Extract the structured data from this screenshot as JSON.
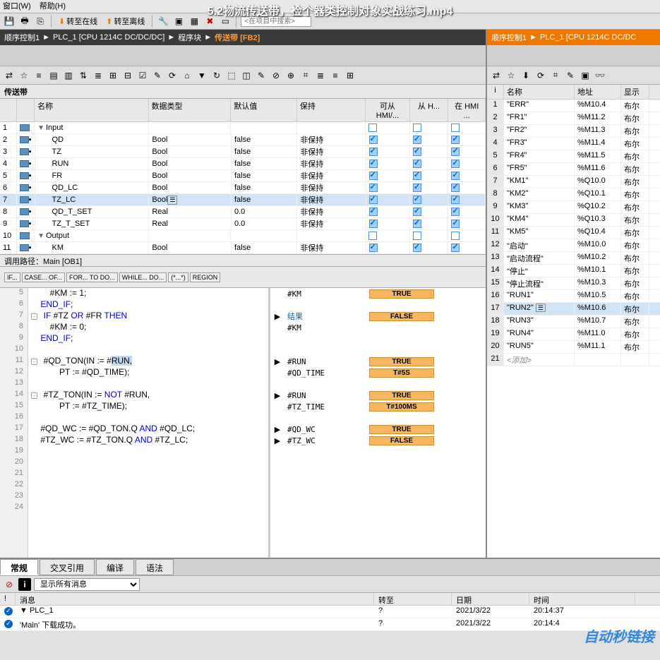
{
  "video_title": "5.2物流传送带，检个器类控制对象实战练习.mp4",
  "menu": {
    "window": "窗口(W)",
    "help": "帮助(H)"
  },
  "toolbar1": {
    "go_online": "转至在线",
    "go_offline": "转至离线",
    "search_placeholder": "<在项目中搜索>"
  },
  "breadcrumb_left": {
    "project": "顺序控制1",
    "plc": "PLC_1 [CPU 1214C DC/DC/DC]",
    "blocks": "程序块",
    "fb": "传送带 [FB2]"
  },
  "breadcrumb_right": {
    "project": "顺序控制1",
    "plc": "PLC_1 [CPU 1214C DC/DC"
  },
  "fb_title": "传送带",
  "var_headers": {
    "name": "名称",
    "dtype": "数据类型",
    "default": "默认值",
    "hold": "保持",
    "hmi1": "可从 HMI/...",
    "hmi2": "从 H...",
    "hmi3": "在 HMI ..."
  },
  "var_rows": [
    {
      "num": "1",
      "section": true,
      "name": "Input",
      "arrow": "▼"
    },
    {
      "num": "2",
      "name": "QD",
      "dtype": "Bool",
      "default": "false",
      "hold": "非保持",
      "c1": true,
      "c2": true,
      "c3": true
    },
    {
      "num": "3",
      "name": "TZ",
      "dtype": "Bool",
      "default": "false",
      "hold": "非保持",
      "c1": true,
      "c2": true,
      "c3": true
    },
    {
      "num": "4",
      "name": "RUN",
      "dtype": "Bool",
      "default": "false",
      "hold": "非保持",
      "c1": true,
      "c2": true,
      "c3": true
    },
    {
      "num": "5",
      "name": "FR",
      "dtype": "Bool",
      "default": "false",
      "hold": "非保持",
      "c1": true,
      "c2": true,
      "c3": true
    },
    {
      "num": "6",
      "name": "QD_LC",
      "dtype": "Bool",
      "default": "false",
      "hold": "非保持",
      "c1": true,
      "c2": true,
      "c3": true
    },
    {
      "num": "7",
      "name": "TZ_LC",
      "dtype": "Bool",
      "default": "false",
      "hold": "非保持",
      "c1": true,
      "c2": true,
      "c3": true,
      "selected": true,
      "dd": true
    },
    {
      "num": "8",
      "name": "QD_T_SET",
      "dtype": "Real",
      "default": "0.0",
      "hold": "非保持",
      "c1": true,
      "c2": true,
      "c3": true
    },
    {
      "num": "9",
      "name": "TZ_T_SET",
      "dtype": "Real",
      "default": "0.0",
      "hold": "非保持",
      "c1": true,
      "c2": true,
      "c3": true
    },
    {
      "num": "10",
      "section": true,
      "name": "Output",
      "arrow": "▼"
    },
    {
      "num": "11",
      "name": "KM",
      "dtype": "Bool",
      "default": "false",
      "hold": "非保持",
      "c1": true,
      "c2": true,
      "c3": true
    }
  ],
  "callpath": "调用路径：Main [OB1]",
  "code_toolbar": [
    "IF...",
    "CASE...\nOF...",
    "FOR...\nTO DO...",
    "WHILE...\nDO...",
    "(*...*)",
    "REGION"
  ],
  "code_lines": [
    {
      "n": 5,
      "text": "      #KM := 1;"
    },
    {
      "n": 6,
      "text": "  END_IF;",
      "kw": "END_IF"
    },
    {
      "n": 7,
      "text": "  IF #TZ OR #FR THEN",
      "kw": "IF",
      "fold": true
    },
    {
      "n": 8,
      "text": "      #KM := 0;"
    },
    {
      "n": 9,
      "text": "  END_IF;",
      "kw": "END_IF"
    },
    {
      "n": 10,
      "text": ""
    },
    {
      "n": 11,
      "text": "  #QD_TON(IN := #RUN,",
      "fold": true,
      "hl_start": 17,
      "hl_end": 22
    },
    {
      "n": 12,
      "text": "          PT := #QD_TIME);"
    },
    {
      "n": 13,
      "text": ""
    },
    {
      "n": 14,
      "text": "  #TZ_TON(IN := NOT #RUN,",
      "fold": true
    },
    {
      "n": 15,
      "text": "          PT := #TZ_TIME);"
    },
    {
      "n": 16,
      "text": ""
    },
    {
      "n": 17,
      "text": "  #QD_WC := #QD_TON.Q AND #QD_LC;"
    },
    {
      "n": 18,
      "text": "  #TZ_WC := #TZ_TON.Q AND #TZ_LC;"
    },
    {
      "n": 19,
      "text": ""
    },
    {
      "n": 20,
      "text": ""
    },
    {
      "n": 21,
      "text": ""
    },
    {
      "n": 22,
      "text": ""
    },
    {
      "n": 23,
      "text": ""
    },
    {
      "n": 24,
      "text": ""
    }
  ],
  "watch": [
    {
      "row": 5,
      "name": "#KM",
      "val": "TRUE"
    },
    {
      "row": 6
    },
    {
      "row": 7,
      "name": "结果",
      "val": "FALSE",
      "marker": "▶",
      "link": true
    },
    {
      "row": 8,
      "name": "#KM"
    },
    {
      "row": 9
    },
    {
      "row": 10
    },
    {
      "row": 11,
      "name": "#RUN",
      "val": "TRUE",
      "marker": "▶"
    },
    {
      "row": 12,
      "name": "#QD_TIME",
      "val": "T#5S"
    },
    {
      "row": 13
    },
    {
      "row": 14,
      "name": "#RUN",
      "val": "TRUE",
      "marker": "▶"
    },
    {
      "row": 15,
      "name": "#TZ_TIME",
      "val": "T#100MS"
    },
    {
      "row": 16
    },
    {
      "row": 17,
      "name": "#QD_WC",
      "val": "TRUE",
      "marker": "▶"
    },
    {
      "row": 18,
      "name": "#TZ_WC",
      "val": "FALSE",
      "marker": "▶"
    },
    {
      "row": 19
    },
    {
      "row": 20
    },
    {
      "row": 21
    },
    {
      "row": 22
    },
    {
      "row": 23
    },
    {
      "row": 24
    }
  ],
  "tag_headers": {
    "info": "i",
    "name": "名称",
    "addr": "地址",
    "type": "显示"
  },
  "tag_rows": [
    {
      "num": "1",
      "name": "\"ERR\"",
      "addr": "%M10.4",
      "type": "布尔"
    },
    {
      "num": "2",
      "name": "\"FR1\"",
      "addr": "%M11.2",
      "type": "布尔"
    },
    {
      "num": "3",
      "name": "\"FR2\"",
      "addr": "%M11.3",
      "type": "布尔"
    },
    {
      "num": "4",
      "name": "\"FR3\"",
      "addr": "%M11.4",
      "type": "布尔"
    },
    {
      "num": "5",
      "name": "\"FR4\"",
      "addr": "%M11.5",
      "type": "布尔"
    },
    {
      "num": "6",
      "name": "\"FR5\"",
      "addr": "%M11.6",
      "type": "布尔"
    },
    {
      "num": "7",
      "name": "\"KM1\"",
      "addr": "%Q10.0",
      "type": "布尔"
    },
    {
      "num": "8",
      "name": "\"KM2\"",
      "addr": "%Q10.1",
      "type": "布尔"
    },
    {
      "num": "9",
      "name": "\"KM3\"",
      "addr": "%Q10.2",
      "type": "布尔"
    },
    {
      "num": "10",
      "name": "\"KM4\"",
      "addr": "%Q10.3",
      "type": "布尔"
    },
    {
      "num": "11",
      "name": "\"KM5\"",
      "addr": "%Q10.4",
      "type": "布尔"
    },
    {
      "num": "12",
      "name": "\"启动\"",
      "addr": "%M10.0",
      "type": "布尔"
    },
    {
      "num": "13",
      "name": "\"启动流程\"",
      "addr": "%M10.2",
      "type": "布尔"
    },
    {
      "num": "14",
      "name": "\"停止\"",
      "addr": "%M10.1",
      "type": "布尔"
    },
    {
      "num": "15",
      "name": "\"停止流程\"",
      "addr": "%M10.3",
      "type": "布尔"
    },
    {
      "num": "16",
      "name": "\"RUN1\"",
      "addr": "%M10.5",
      "type": "布尔"
    },
    {
      "num": "17",
      "name": "\"RUN2\"",
      "addr": "%M10.6",
      "type": "布尔",
      "selected": true,
      "dd": true
    },
    {
      "num": "18",
      "name": "\"RUN3\"",
      "addr": "%M10.7",
      "type": "布尔"
    },
    {
      "num": "19",
      "name": "\"RUN4\"",
      "addr": "%M11.0",
      "type": "布尔"
    },
    {
      "num": "20",
      "name": "\"RUN5\"",
      "addr": "%M11.1",
      "type": "布尔"
    },
    {
      "num": "21",
      "name": "<添加>",
      "add": true
    }
  ],
  "bottom_tabs": {
    "general": "常规",
    "xref": "交叉引用",
    "compile": "编译",
    "syntax": "语法"
  },
  "msg_dropdown": "显示所有消息",
  "msg_headers": {
    "msg": "消息",
    "goto": "转至",
    "date": "日期",
    "time": "时间"
  },
  "msg_rows": [
    {
      "icon": "ok",
      "msg": "▼  PLC_1",
      "date": "2021/3/22",
      "time": "20:14:37"
    },
    {
      "icon": "ok",
      "msg": "      'Main' 下载成功。",
      "date": "2021/3/22",
      "time": "20:14:4"
    }
  ],
  "watermark": "自动秒链接"
}
